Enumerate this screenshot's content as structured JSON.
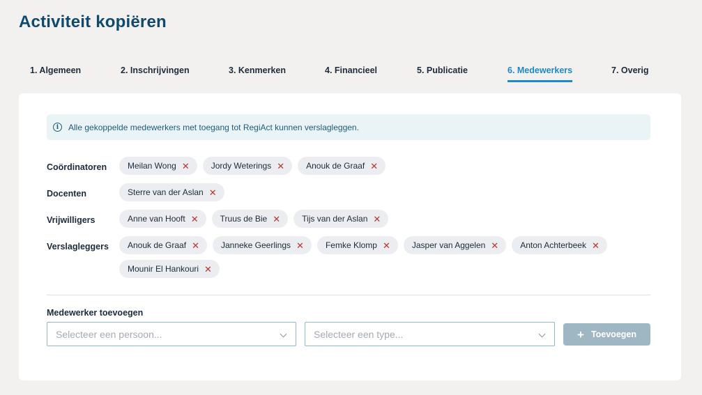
{
  "page": {
    "title": "Activiteit kopiëren"
  },
  "tabs": [
    {
      "label": "1. Algemeen",
      "active": false
    },
    {
      "label": "2. Inschrijvingen",
      "active": false
    },
    {
      "label": "3. Kenmerken",
      "active": false
    },
    {
      "label": "4. Financieel",
      "active": false
    },
    {
      "label": "5. Publicatie",
      "active": false
    },
    {
      "label": "6. Medewerkers",
      "active": true
    },
    {
      "label": "7. Overig",
      "active": false
    }
  ],
  "info": {
    "icon": "info-icon",
    "text": "Alle gekoppelde medewerkers met toegang tot RegiAct kunnen verslagleggen."
  },
  "groups": [
    {
      "label": "Coördinatoren",
      "people": [
        "Meilan Wong",
        "Jordy Weterings",
        "Anouk de Graaf"
      ]
    },
    {
      "label": "Docenten",
      "people": [
        "Sterre van der Aslan"
      ]
    },
    {
      "label": "Vrijwilligers",
      "people": [
        "Anne van Hooft",
        "Truus de Bie",
        "Tijs van der Aslan"
      ]
    },
    {
      "label": "Verslagleggers",
      "people": [
        "Anouk de Graaf",
        "Janneke Geerlings",
        "Femke Klomp",
        "Jasper van Aggelen",
        "Anton Achterbeek",
        "Mounir El Hankouri"
      ]
    }
  ],
  "remove_glyph": "✕",
  "add": {
    "label": "Medewerker toevoegen",
    "person_placeholder": "Selecteer een persoon...",
    "type_placeholder": "Selecteer een type...",
    "button_label": "Toevoegen"
  },
  "colors": {
    "accent": "#1e88c9",
    "title": "#0f4a6e",
    "remove": "#c0322b",
    "button_disabled": "#9fb7c3"
  }
}
